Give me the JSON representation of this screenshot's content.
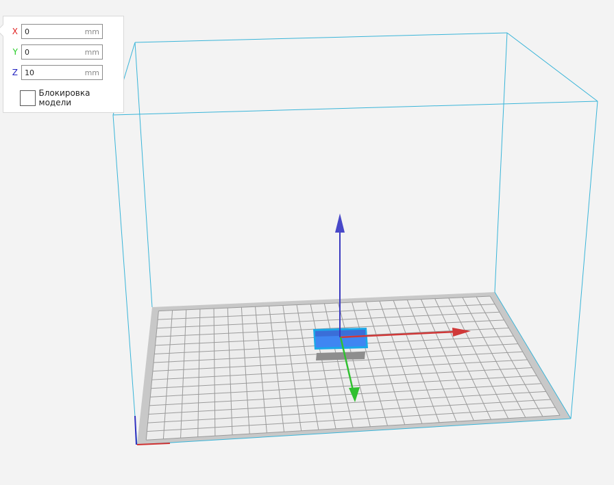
{
  "panel": {
    "fields": [
      {
        "axis": "X",
        "value": "0",
        "unit": "mm",
        "color": "#e02020"
      },
      {
        "axis": "Y",
        "value": "0",
        "unit": "mm",
        "color": "#22cc22"
      },
      {
        "axis": "Z",
        "value": "10",
        "unit": "mm",
        "color": "#2020c0"
      }
    ],
    "lock_label": "Блокировка модели"
  },
  "colors": {
    "volume": "#38b4d8",
    "model": "#3a8ef0",
    "x_axis": "#d03030",
    "y_axis": "#30c030",
    "z_axis": "#3030c0"
  }
}
